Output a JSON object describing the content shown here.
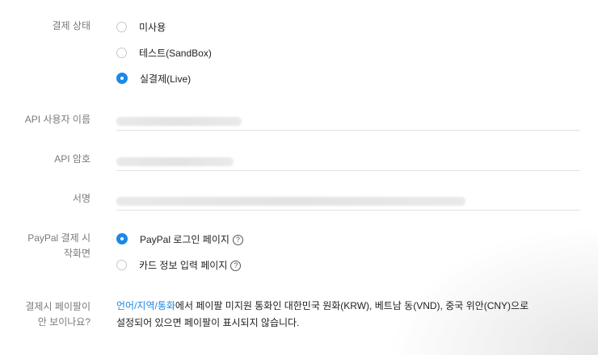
{
  "payment_status": {
    "label": "결제 상태",
    "options": [
      "미사용",
      "테스트(SandBox)",
      "실결제(Live)"
    ],
    "selected": "실결제(Live)"
  },
  "api_username": {
    "label": "API 사용자 이름"
  },
  "api_password": {
    "label": "API 암호"
  },
  "signature": {
    "label": "서명"
  },
  "paypal_start": {
    "label_line1": "PayPal 결제 시",
    "label_line2": "작화면",
    "options": [
      "PayPal 로그인 페이지",
      "카드 정보 입력 페이지"
    ],
    "selected": "PayPal 로그인 페이지",
    "help_glyph": "?"
  },
  "paypal_missing": {
    "label_line1": "결제시 페이팔이",
    "label_line2": "안 보이나요?",
    "link_text": "언어/지역/통화",
    "text_line1": "에서 페이팔 미지원 통화인 대한민국 원화(KRW), 베트남 동(VND), 중국 위안(CNY)으로",
    "text_line2": "설정되어 있으면 페이팔이 표시되지 않습니다."
  },
  "colors": {
    "accent": "#1e88e5",
    "label": "#7a7a7a",
    "divider": "#e2e2e2"
  }
}
